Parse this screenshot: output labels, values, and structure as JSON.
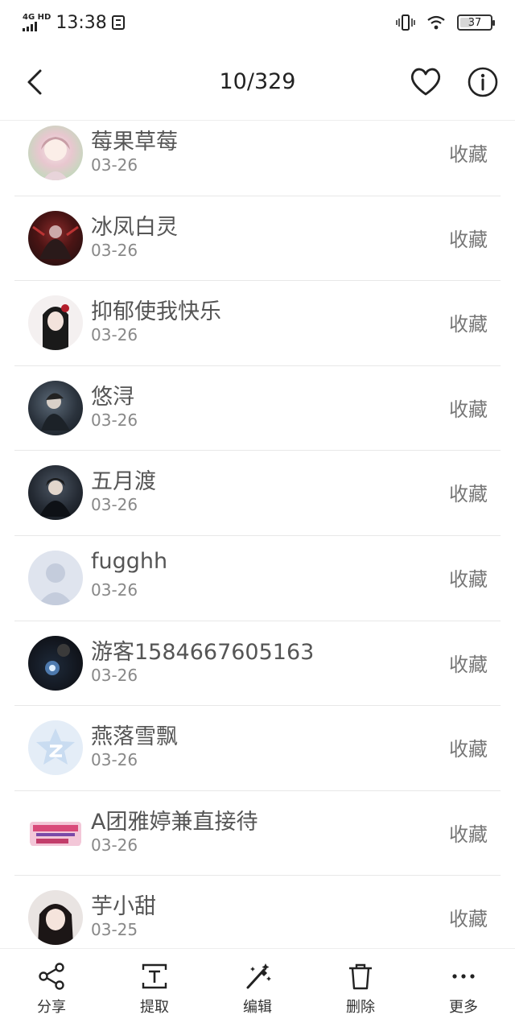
{
  "status_bar": {
    "network": "4G HD",
    "time": "13:38",
    "battery": "37"
  },
  "header": {
    "title": "10/329"
  },
  "list": [
    {
      "name": "莓果草莓",
      "date": "03-26",
      "action": "收藏",
      "avatar": "anime-girl-pink"
    },
    {
      "name": "冰凤白灵",
      "date": "03-26",
      "action": "收藏",
      "avatar": "dark-red-figure"
    },
    {
      "name": "抑郁使我快乐",
      "date": "03-26",
      "action": "收藏",
      "avatar": "girl-black-hair-rose"
    },
    {
      "name": "悠浔",
      "date": "03-26",
      "action": "收藏",
      "avatar": "dark-anime-figure"
    },
    {
      "name": "五月渡",
      "date": "03-26",
      "action": "收藏",
      "avatar": "dark-anime-boy"
    },
    {
      "name": "fugghh",
      "date": "03-26",
      "action": "收藏",
      "avatar": "default-user"
    },
    {
      "name": "游客1584667605163",
      "date": "03-26",
      "action": "收藏",
      "avatar": "dark-space-glow"
    },
    {
      "name": "燕落雪飘",
      "date": "03-26",
      "action": "收藏",
      "avatar": "qq-star-logo"
    },
    {
      "name": "A团雅婷兼直接待",
      "date": "03-26",
      "action": "收藏",
      "avatar": "recruit-banner"
    },
    {
      "name": "芋小甜",
      "date": "03-25",
      "action": "收藏",
      "avatar": "girl-photo"
    }
  ],
  "toolbar": {
    "share": "分享",
    "extract": "提取",
    "edit": "编辑",
    "delete": "删除",
    "more": "更多"
  }
}
